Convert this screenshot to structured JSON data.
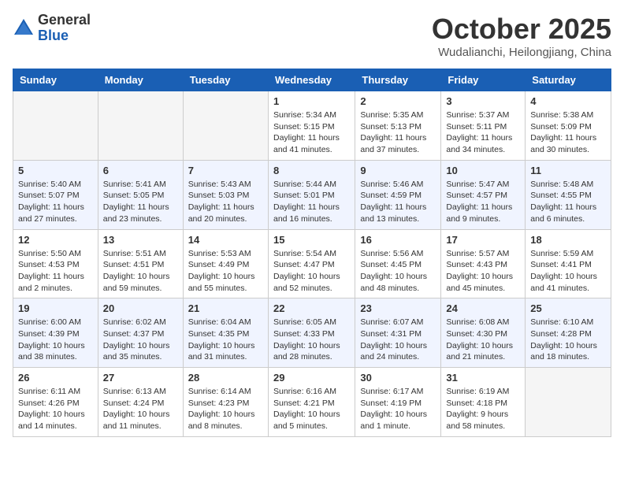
{
  "header": {
    "logo_general": "General",
    "logo_blue": "Blue",
    "month_title": "October 2025",
    "location": "Wudalianchi, Heilongjiang, China"
  },
  "weekdays": [
    "Sunday",
    "Monday",
    "Tuesday",
    "Wednesday",
    "Thursday",
    "Friday",
    "Saturday"
  ],
  "weeks": [
    [
      {
        "day": "",
        "info": ""
      },
      {
        "day": "",
        "info": ""
      },
      {
        "day": "",
        "info": ""
      },
      {
        "day": "1",
        "info": "Sunrise: 5:34 AM\nSunset: 5:15 PM\nDaylight: 11 hours\nand 41 minutes."
      },
      {
        "day": "2",
        "info": "Sunrise: 5:35 AM\nSunset: 5:13 PM\nDaylight: 11 hours\nand 37 minutes."
      },
      {
        "day": "3",
        "info": "Sunrise: 5:37 AM\nSunset: 5:11 PM\nDaylight: 11 hours\nand 34 minutes."
      },
      {
        "day": "4",
        "info": "Sunrise: 5:38 AM\nSunset: 5:09 PM\nDaylight: 11 hours\nand 30 minutes."
      }
    ],
    [
      {
        "day": "5",
        "info": "Sunrise: 5:40 AM\nSunset: 5:07 PM\nDaylight: 11 hours\nand 27 minutes."
      },
      {
        "day": "6",
        "info": "Sunrise: 5:41 AM\nSunset: 5:05 PM\nDaylight: 11 hours\nand 23 minutes."
      },
      {
        "day": "7",
        "info": "Sunrise: 5:43 AM\nSunset: 5:03 PM\nDaylight: 11 hours\nand 20 minutes."
      },
      {
        "day": "8",
        "info": "Sunrise: 5:44 AM\nSunset: 5:01 PM\nDaylight: 11 hours\nand 16 minutes."
      },
      {
        "day": "9",
        "info": "Sunrise: 5:46 AM\nSunset: 4:59 PM\nDaylight: 11 hours\nand 13 minutes."
      },
      {
        "day": "10",
        "info": "Sunrise: 5:47 AM\nSunset: 4:57 PM\nDaylight: 11 hours\nand 9 minutes."
      },
      {
        "day": "11",
        "info": "Sunrise: 5:48 AM\nSunset: 4:55 PM\nDaylight: 11 hours\nand 6 minutes."
      }
    ],
    [
      {
        "day": "12",
        "info": "Sunrise: 5:50 AM\nSunset: 4:53 PM\nDaylight: 11 hours\nand 2 minutes."
      },
      {
        "day": "13",
        "info": "Sunrise: 5:51 AM\nSunset: 4:51 PM\nDaylight: 10 hours\nand 59 minutes."
      },
      {
        "day": "14",
        "info": "Sunrise: 5:53 AM\nSunset: 4:49 PM\nDaylight: 10 hours\nand 55 minutes."
      },
      {
        "day": "15",
        "info": "Sunrise: 5:54 AM\nSunset: 4:47 PM\nDaylight: 10 hours\nand 52 minutes."
      },
      {
        "day": "16",
        "info": "Sunrise: 5:56 AM\nSunset: 4:45 PM\nDaylight: 10 hours\nand 48 minutes."
      },
      {
        "day": "17",
        "info": "Sunrise: 5:57 AM\nSunset: 4:43 PM\nDaylight: 10 hours\nand 45 minutes."
      },
      {
        "day": "18",
        "info": "Sunrise: 5:59 AM\nSunset: 4:41 PM\nDaylight: 10 hours\nand 41 minutes."
      }
    ],
    [
      {
        "day": "19",
        "info": "Sunrise: 6:00 AM\nSunset: 4:39 PM\nDaylight: 10 hours\nand 38 minutes."
      },
      {
        "day": "20",
        "info": "Sunrise: 6:02 AM\nSunset: 4:37 PM\nDaylight: 10 hours\nand 35 minutes."
      },
      {
        "day": "21",
        "info": "Sunrise: 6:04 AM\nSunset: 4:35 PM\nDaylight: 10 hours\nand 31 minutes."
      },
      {
        "day": "22",
        "info": "Sunrise: 6:05 AM\nSunset: 4:33 PM\nDaylight: 10 hours\nand 28 minutes."
      },
      {
        "day": "23",
        "info": "Sunrise: 6:07 AM\nSunset: 4:31 PM\nDaylight: 10 hours\nand 24 minutes."
      },
      {
        "day": "24",
        "info": "Sunrise: 6:08 AM\nSunset: 4:30 PM\nDaylight: 10 hours\nand 21 minutes."
      },
      {
        "day": "25",
        "info": "Sunrise: 6:10 AM\nSunset: 4:28 PM\nDaylight: 10 hours\nand 18 minutes."
      }
    ],
    [
      {
        "day": "26",
        "info": "Sunrise: 6:11 AM\nSunset: 4:26 PM\nDaylight: 10 hours\nand 14 minutes."
      },
      {
        "day": "27",
        "info": "Sunrise: 6:13 AM\nSunset: 4:24 PM\nDaylight: 10 hours\nand 11 minutes."
      },
      {
        "day": "28",
        "info": "Sunrise: 6:14 AM\nSunset: 4:23 PM\nDaylight: 10 hours\nand 8 minutes."
      },
      {
        "day": "29",
        "info": "Sunrise: 6:16 AM\nSunset: 4:21 PM\nDaylight: 10 hours\nand 5 minutes."
      },
      {
        "day": "30",
        "info": "Sunrise: 6:17 AM\nSunset: 4:19 PM\nDaylight: 10 hours\nand 1 minute."
      },
      {
        "day": "31",
        "info": "Sunrise: 6:19 AM\nSunset: 4:18 PM\nDaylight: 9 hours\nand 58 minutes."
      },
      {
        "day": "",
        "info": ""
      }
    ]
  ]
}
